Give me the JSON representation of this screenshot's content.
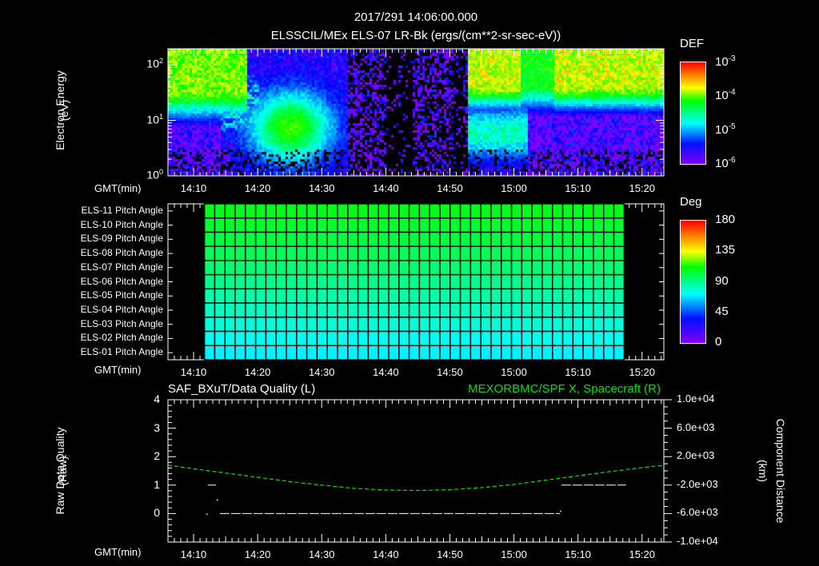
{
  "header": {
    "datetime": "2017/291 14:06:00.000",
    "subtitle": "ELSSCIL/MEx ELS-07 LR-Bk  (ergs/(cm**2-sr-sec-eV))"
  },
  "colors": {
    "background": "#000000",
    "axis": "#ffffff",
    "spacecraft_line": "#00e000",
    "quality_line": "#ffffff"
  },
  "chart_data": [
    {
      "type": "heatmap",
      "name": "electron-energy-spectrogram",
      "ylabel": "Electron Energy",
      "yunit": "(eV)",
      "xlabel": "GMT(min)",
      "yscale": "log",
      "ylim": [
        1,
        195
      ],
      "yticks": [
        {
          "base": "10",
          "exp": "0",
          "value": 1
        },
        {
          "base": "10",
          "exp": "1",
          "value": 10
        },
        {
          "base": "10",
          "exp": "2",
          "value": 100
        }
      ],
      "xlim_minutes_after_1400": [
        6,
        83.4
      ],
      "xticks": [
        "14:10",
        "14:20",
        "14:30",
        "14:40",
        "14:50",
        "15:00",
        "15:10",
        "15:20"
      ],
      "colorbar": {
        "label": "DEF",
        "scale": "log",
        "range": [
          1e-06,
          0.001
        ],
        "ticks": [
          {
            "base": "10",
            "exp": "-3"
          },
          {
            "base": "10",
            "exp": "-4"
          },
          {
            "base": "10",
            "exp": "-5"
          },
          {
            "base": "10",
            "exp": "-6"
          }
        ]
      },
      "background_log_def": -6.2,
      "features": [
        {
          "t": [
            6,
            18
          ],
          "log_energy": [
            1.3,
            2.29
          ],
          "log_def": -3.8
        },
        {
          "t": [
            17,
            33
          ],
          "log_energy": [
            0.4,
            1.4
          ],
          "log_def": -4.4
        },
        {
          "t": [
            35,
            52
          ],
          "log_energy": [
            0,
            2.29
          ],
          "log_def": -6.3,
          "sparse": true
        },
        {
          "t": [
            53,
            83.4
          ],
          "log_energy": [
            1.3,
            2.29
          ],
          "log_def": -3.8
        },
        {
          "t": [
            53,
            62
          ],
          "log_energy": [
            0.4,
            1.2
          ],
          "log_def": -4.8
        }
      ]
    },
    {
      "type": "heatmap",
      "name": "pitch-angle",
      "xlabel": "GMT(min)",
      "rows": [
        "ELS-11 Pitch Angle",
        "ELS-10 Pitch Angle",
        "ELS-09 Pitch Angle",
        "ELS-08 Pitch Angle",
        "ELS-07 Pitch Angle",
        "ELS-06 Pitch Angle",
        "ELS-05 Pitch Angle",
        "ELS-04 Pitch Angle",
        "ELS-03 Pitch Angle",
        "ELS-02 Pitch Angle",
        "ELS-01 Pitch Angle"
      ],
      "row_values_deg": [
        96,
        93,
        90,
        86,
        82,
        78,
        74,
        70,
        66,
        62,
        58
      ],
      "data_time_range_minutes": [
        11.7,
        77.2
      ],
      "column_count": 41,
      "xticks": [
        "14:10",
        "14:20",
        "14:30",
        "14:40",
        "14:50",
        "15:00",
        "15:10",
        "15:20"
      ],
      "colorbar": {
        "label": "Deg",
        "range": [
          0,
          180
        ],
        "ticks": [
          "180",
          "135",
          "90",
          "45",
          "0"
        ]
      }
    },
    {
      "type": "line",
      "name": "quality-and-position",
      "title_left": "SAF_BXuT/Data Quality (L)",
      "title_right": "MEXORBMC/SPF X, Spacecraft (R)",
      "ylabel_left": [
        "Raw Data Quality",
        "(Raw)"
      ],
      "ylabel_right": [
        "Component Distance",
        "(km)"
      ],
      "xlabel": "GMT(min)",
      "ylim_left": [
        -1,
        4
      ],
      "yticks_left": [
        "4",
        "3",
        "2",
        "1",
        "0"
      ],
      "ylim_right": [
        -10000,
        10000
      ],
      "yticks_right": [
        "1.0e+04",
        "6.0e+03",
        "2.0e+03",
        "-2.0e+03",
        "-6.0e+03",
        "-1.0e+04"
      ],
      "xticks": [
        "14:10",
        "14:20",
        "14:30",
        "14:40",
        "14:50",
        "15:00",
        "15:10",
        "15:20"
      ],
      "series": [
        {
          "name": "Data Quality",
          "axis": "left",
          "segments": [
            {
              "t": [
                12.2,
                13.5
              ],
              "value": 1
            },
            {
              "t": [
                14.1,
                67.2
              ],
              "value": 0
            },
            {
              "t": [
                67.4,
                77.5
              ],
              "value": 1
            }
          ],
          "points": [
            {
              "t": 12.0,
              "value": 0
            },
            {
              "t": 13.6,
              "value": 0.5
            },
            {
              "t": 67.2,
              "value": 0.1
            }
          ]
        },
        {
          "name": "MEXORBMC/SPF X",
          "axis": "right",
          "t": [
            6,
            10,
            15,
            20,
            25,
            30,
            35,
            40,
            45,
            50,
            55,
            60,
            65,
            70,
            75,
            80,
            83.4
          ],
          "values": [
            800,
            300,
            -300,
            -900,
            -1500,
            -2000,
            -2450,
            -2700,
            -2750,
            -2650,
            -2350,
            -1900,
            -1300,
            -700,
            -100,
            450,
            800
          ]
        }
      ]
    }
  ]
}
